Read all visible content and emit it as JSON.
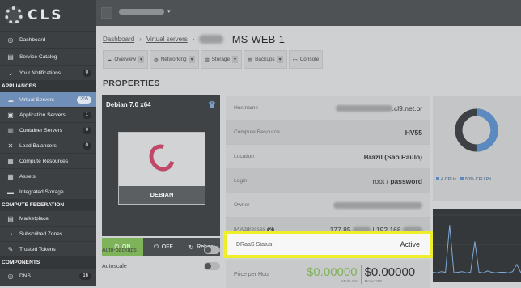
{
  "logo_text": "CLS",
  "sidebar": {
    "items": [
      {
        "label": "Dashboard",
        "icon": "dashboard-icon",
        "glyph": "◎"
      },
      {
        "label": "Service Catalog",
        "icon": "catalog-icon",
        "glyph": "▤"
      },
      {
        "label": "Your Notifications",
        "icon": "bell-icon",
        "glyph": "♪",
        "count": "0"
      }
    ],
    "appliances_title": "APPLIANCES",
    "appliances": [
      {
        "label": "Virtual Servers",
        "icon": "cloud-icon",
        "glyph": "☁",
        "count": "205",
        "active": true
      },
      {
        "label": "Application Servers",
        "icon": "app-server-icon",
        "glyph": "▣",
        "count": "1"
      },
      {
        "label": "Container Servers",
        "icon": "container-icon",
        "glyph": "▥",
        "count": "0"
      },
      {
        "label": "Load Balancers",
        "icon": "balancer-icon",
        "glyph": "✕",
        "count": "0"
      },
      {
        "label": "Compute Resources",
        "icon": "compute-icon",
        "glyph": "▦"
      },
      {
        "label": "Assets",
        "icon": "assets-icon",
        "glyph": "▦"
      },
      {
        "label": "Integrated Storage",
        "icon": "storage-icon",
        "glyph": "▬"
      }
    ],
    "federation_title": "COMPUTE FEDERATION",
    "federation": [
      {
        "label": "Marketplace",
        "icon": "marketplace-icon",
        "glyph": "▤"
      },
      {
        "label": "Subscribed Zones",
        "icon": "zones-icon",
        "glyph": "◔"
      },
      {
        "label": "Trusted Tokens",
        "icon": "token-icon",
        "glyph": "✎"
      }
    ],
    "components_title": "COMPONENTS",
    "components": [
      {
        "label": "DNS",
        "icon": "dns-icon",
        "glyph": "◎",
        "count": "16"
      }
    ]
  },
  "breadcrumb": {
    "dashboard": "Dashboard",
    "virtual_servers": "Virtual servers",
    "title": "-MS-WEB-1"
  },
  "tabs": [
    {
      "label": "Overview",
      "icon": "overview-icon",
      "glyph": "☁",
      "dropdown": true
    },
    {
      "label": "Networking",
      "icon": "network-icon",
      "glyph": "◍",
      "dropdown": true
    },
    {
      "label": "Storage",
      "icon": "storage-tab-icon",
      "glyph": "▥",
      "dropdown": true
    },
    {
      "label": "Backups",
      "icon": "backup-icon",
      "glyph": "▤",
      "dropdown": true
    },
    {
      "label": "Console",
      "icon": "console-icon",
      "glyph": "▭",
      "dropdown": false
    }
  ],
  "properties_heading": "PROPERTIES",
  "vm": {
    "os_title": "Debian 7.0 x64",
    "os_name": "DEBIAN",
    "power_on": "ON",
    "power_off": "OFF",
    "reboot": "Reboot",
    "auto_backups": "Auto-backups",
    "autoscale": "Autoscale"
  },
  "info": {
    "hostname_label": "Hostname",
    "hostname_value": ".cl9.net.br",
    "compute_label": "Compute Resource",
    "compute_value": "HV55",
    "location_label": "Location",
    "location_value": "Brazil (Sao Paulo)",
    "login_label": "Login",
    "login_user": "root / ",
    "login_pass": "password",
    "owner_label": "Owner",
    "ip_label": "IP Addresses",
    "ip_count": "2",
    "ip_value_1": "177.85.",
    "ip_value_2": "| 192.168.",
    "draas_label": "DRaaS Status",
    "draas_value": "Active",
    "price_label": "Price per Hour",
    "price_on": "$0.00000",
    "price_on_sub": "Mode ON",
    "price_off": "$0.00000",
    "price_off_sub": "Mode OFF"
  },
  "cpu": {
    "legend_cpus": "4 CPUs",
    "legend_pct": "50% CPU Pri...",
    "donut_fill": 0.5,
    "colors": {
      "fill": "#5a8ac0",
      "rest": "#3d4145"
    }
  },
  "graph": {
    "points": [
      0.92,
      0.93,
      0.91,
      0.92,
      0.2,
      0.93,
      0.92,
      0.91,
      0.93,
      0.92,
      0.45,
      0.92,
      0.93,
      0.9,
      0.92,
      0.93,
      0.92,
      0.92,
      0.93,
      0.91,
      0.8,
      0.93
    ]
  }
}
